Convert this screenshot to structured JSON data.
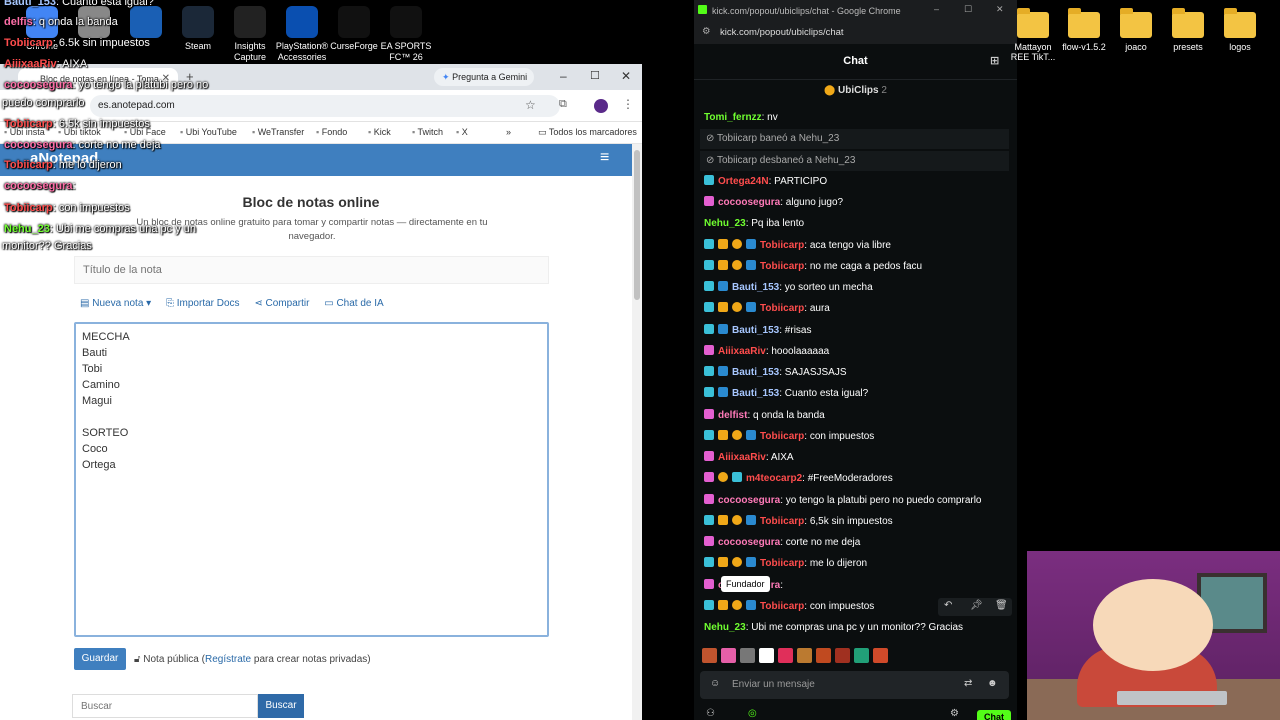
{
  "desktop": {
    "icons_left": [
      {
        "label": "Chrome",
        "color": "#4285f4"
      },
      {
        "label": "",
        "color": "#888888"
      },
      {
        "label": "",
        "color": "#1a5fb4"
      },
      {
        "label": "Steam",
        "color": "#1b2838"
      },
      {
        "label": "Insights Capture",
        "color": "#222222"
      },
      {
        "label": "PlayStation® Accessories",
        "color": "#0a4fb0"
      },
      {
        "label": "CurseForge",
        "color": "#111111"
      },
      {
        "label": "EA SPORTS FC™ 26",
        "color": "#111111"
      }
    ],
    "icons_right": [
      {
        "label": "Mattayon REE TikT..."
      },
      {
        "label": "flow-v1.5.2"
      },
      {
        "label": "joaco"
      },
      {
        "label": "presets"
      },
      {
        "label": "logos"
      }
    ]
  },
  "overlay_chat": [
    {
      "user": "Bauti_153",
      "text": ": Cuanto esta igual?",
      "color": "#a7c7ff"
    },
    {
      "user": "delfis",
      "text": ": q onda la banda",
      "color": "#ff6fa8"
    },
    {
      "user": "Tobiicarp",
      "text": ": 6.5k sin impuestos",
      "color": "#ff4d4d"
    },
    {
      "user": "AiiixaaRiv",
      "text": ": AIXA",
      "color": "#ff4d4d"
    },
    {
      "user": "cocoosegura",
      "text": ": yo tengo la platubi pero no",
      "color": "#ff6fa8"
    },
    {
      "user": "",
      "text": "puedo comprarlo",
      "color": "#ffffff"
    },
    {
      "user": "Tobiicarp",
      "text": ": 6.5k sin impuestos",
      "color": "#ff4d4d"
    },
    {
      "user": "cocoosegura",
      "text": ": corte no me deja",
      "color": "#ff6fa8"
    },
    {
      "user": "Tobiicarp",
      "text": ": me lo dijeron",
      "color": "#ff4d4d"
    },
    {
      "user": "cocoosegura",
      "text": ":",
      "color": "#ff6fa8"
    },
    {
      "user": "Tobiicarp",
      "text": ": con impuestos",
      "color": "#ff4d4d"
    },
    {
      "user": "Nehu_23",
      "text": ": Ubi me compras una pc y un",
      "color": "#70ff30"
    },
    {
      "user": "",
      "text": "monitor?? Gracias",
      "color": "#ffffff"
    }
  ],
  "browser": {
    "tab_title": "Bloc de notas en línea - Toma",
    "gemini_label": "Pregunta a Gemini",
    "url": "es.anotepad.com",
    "bookmarks": [
      "Ubi insta",
      "Ubi tiktok",
      "Ubi Face",
      "Ubi YouTube",
      "WeTransfer",
      "Fondo",
      "Kick",
      "Twitch",
      "X"
    ],
    "all_bookmarks": "Todos los marcadores"
  },
  "anotepad": {
    "logo": "aNotepad",
    "heading": "Bloc de notas online",
    "subtitle": "Un bloc de notas online gratuito para tomar y compartir notas — directamente en tu navegador.",
    "title_placeholder": "Título de la nota",
    "toolbar": {
      "new_note": "Nueva nota",
      "import": "Importar Docs",
      "share": "Compartir",
      "ai_chat": "Chat de IA"
    },
    "note_lines": [
      "MECCHA",
      "Bauti",
      "Tobi",
      "Camino",
      "Magui",
      "",
      "SORTEO",
      "Coco",
      "Ortega",
      ""
    ],
    "save": "Guardar",
    "public_note_prefix": "Nota pública (",
    "register": "Regístrate",
    "public_note_suffix": " para crear notas privadas)",
    "search_placeholder": "Buscar",
    "search_button": "Buscar"
  },
  "kick": {
    "window_title": "kick.com/popout/ubiclips/chat - Google Chrome",
    "url": "kick.com/popout/ubiclips/chat",
    "header": "Chat",
    "pinned": "UbiClips",
    "pinned_count": "2",
    "tooltip": "Fundador",
    "input_placeholder": "Enviar un mensaje",
    "chat_button": "Chat",
    "messages": [
      {
        "type": "user",
        "badges": [],
        "user": "Tomi_fernzz",
        "ucolor": "#70ff30",
        "text": ": nv"
      },
      {
        "type": "sys",
        "text": "Tobiicarp baneó a Nehu_23"
      },
      {
        "type": "sys",
        "text": "Tobiicarp desbaneó a Nehu_23"
      },
      {
        "type": "user",
        "badges": [
          "mod"
        ],
        "user": "Ortega24N",
        "ucolor": "#ff4d4d",
        "text": ": PARTICIPO"
      },
      {
        "type": "user",
        "badges": [
          "og"
        ],
        "user": "cocoosegura",
        "ucolor": "#ff7ab8",
        "text": ": alguno jugo?"
      },
      {
        "type": "user",
        "badges": [],
        "user": "Nehu_23",
        "ucolor": "#70ff30",
        "text": ": Pq iba lento"
      },
      {
        "type": "user",
        "badges": [
          "mod",
          "crown",
          "sub",
          "vip"
        ],
        "user": "Tobiicarp",
        "ucolor": "#ff4d4d",
        "text": ": aca tengo via libre"
      },
      {
        "type": "user",
        "badges": [
          "mod",
          "crown",
          "sub",
          "vip"
        ],
        "user": "Tobiicarp",
        "ucolor": "#ff4d4d",
        "text": ": no me caga a pedos facu"
      },
      {
        "type": "user",
        "badges": [
          "mod",
          "vip"
        ],
        "user": "Bauti_153",
        "ucolor": "#a7c7ff",
        "text": ": yo sorteo un mecha"
      },
      {
        "type": "user",
        "badges": [
          "mod",
          "crown",
          "sub",
          "vip"
        ],
        "user": "Tobiicarp",
        "ucolor": "#ff4d4d",
        "text": ": aura"
      },
      {
        "type": "user",
        "badges": [
          "mod",
          "vip"
        ],
        "user": "Bauti_153",
        "ucolor": "#a7c7ff",
        "text": ": #risas"
      },
      {
        "type": "user",
        "badges": [
          "og"
        ],
        "user": "AiiixaaRiv",
        "ucolor": "#ff4d4d",
        "text": ": hooolaaaaaa"
      },
      {
        "type": "user",
        "badges": [
          "mod",
          "vip"
        ],
        "user": "Bauti_153",
        "ucolor": "#a7c7ff",
        "text": ": SAJASJSAJS"
      },
      {
        "type": "user",
        "badges": [
          "mod",
          "vip"
        ],
        "user": "Bauti_153",
        "ucolor": "#a7c7ff",
        "text": ": Cuanto esta igual?"
      },
      {
        "type": "user",
        "badges": [
          "og"
        ],
        "user": "delfist",
        "ucolor": "#ff7ab8",
        "text": ": q onda la banda"
      },
      {
        "type": "user",
        "badges": [
          "mod",
          "crown",
          "sub",
          "vip"
        ],
        "user": "Tobiicarp",
        "ucolor": "#ff4d4d",
        "text": ": con impuestos"
      },
      {
        "type": "user",
        "badges": [
          "og"
        ],
        "user": "AiiixaaRiv",
        "ucolor": "#ff4d4d",
        "text": ": AIXA"
      },
      {
        "type": "user",
        "badges": [
          "og",
          "sub",
          "mod"
        ],
        "user": "m4teocarp2",
        "ucolor": "#ff4d4d",
        "text": ": #FreeModeradores"
      },
      {
        "type": "user",
        "badges": [
          "og"
        ],
        "user": "cocoosegura",
        "ucolor": "#ff7ab8",
        "text": ": yo tengo la platubi pero no puedo comprarlo"
      },
      {
        "type": "user",
        "badges": [
          "mod",
          "crown",
          "sub",
          "vip"
        ],
        "user": "Tobiicarp",
        "ucolor": "#ff4d4d",
        "text": ": 6,5k sin impuestos"
      },
      {
        "type": "user",
        "badges": [
          "og"
        ],
        "user": "cocoosegura",
        "ucolor": "#ff7ab8",
        "text": ": corte no me deja"
      },
      {
        "type": "user",
        "badges": [
          "mod",
          "crown",
          "sub",
          "vip"
        ],
        "user": "Tobiicarp",
        "ucolor": "#ff4d4d",
        "text": ": me lo dijeron"
      },
      {
        "type": "user",
        "badges": [
          "og"
        ],
        "user": "cocoosegura",
        "ucolor": "#ff7ab8",
        "text": ":"
      },
      {
        "type": "user",
        "badges": [
          "mod",
          "crown",
          "sub",
          "vip"
        ],
        "user": "Tobiicarp",
        "ucolor": "#ff4d4d",
        "text": ": con impuestos"
      },
      {
        "type": "user",
        "badges": [],
        "user": "Nehu_23",
        "ucolor": "#70ff30",
        "text": ": Ubi me compras una pc y un monitor?? Gracias"
      }
    ],
    "emotes": [
      "#c0542e",
      "#e55fa8",
      "#777777",
      "#ffffff",
      "#e02f5a",
      "#bb7a30",
      "#c04a20",
      "#a03020",
      "#21a078",
      "#d04a2a"
    ]
  },
  "colors": {
    "kick_green": "#53fc18",
    "anotepad_blue": "#3f7fbf"
  }
}
